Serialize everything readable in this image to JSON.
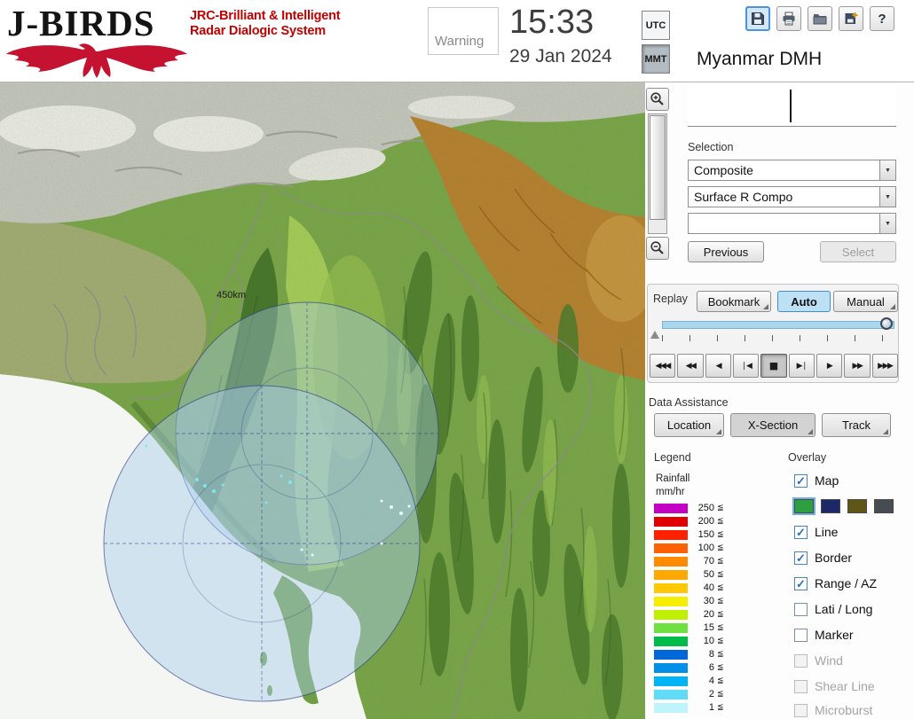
{
  "header": {
    "logo": {
      "title": "J-BIRDS",
      "tagline1": "JRC-Brilliant & Intelligent",
      "tagline2": "Radar  Dialogic  System"
    },
    "warning_label": "Warning",
    "clock": {
      "time": "15:33",
      "date": "29 Jan 2024"
    },
    "timezone": {
      "utc": "UTC",
      "mmt": "MMT",
      "selected": "MMT"
    },
    "toolbar": [
      {
        "name": "save",
        "icon": "floppy-disk"
      },
      {
        "name": "print",
        "icon": "printer"
      },
      {
        "name": "open",
        "icon": "folder"
      },
      {
        "name": "import",
        "icon": "disk-plus"
      },
      {
        "name": "help",
        "icon": "question-mark",
        "glyph": "?"
      }
    ],
    "org_name": "Myanmar DMH"
  },
  "selection_panel": {
    "label": "Selection",
    "dropdowns": [
      {
        "value": "Composite"
      },
      {
        "value": "Surface R Compo"
      },
      {
        "value": ""
      }
    ],
    "previous_label": "Previous",
    "select_label": "Select"
  },
  "replay": {
    "label": "Replay",
    "bookmark_label": "Bookmark",
    "auto_label": "Auto",
    "manual_label": "Manual",
    "playback_buttons": [
      "◀◀◀",
      "◀◀",
      "◀",
      "❘◀",
      "■",
      "▶❘",
      "▶",
      "▶▶",
      "▶▶▶"
    ]
  },
  "data_assistance": {
    "label": "Data Assistance",
    "buttons": [
      "Location",
      "X-Section",
      "Track"
    ]
  },
  "legend": {
    "title": "Legend",
    "unit_line1": "Rainfall",
    "unit_line2": "mm/hr",
    "lte_symbol": "≦",
    "items": [
      {
        "value": "250",
        "color": "#c400c4"
      },
      {
        "value": "200",
        "color": "#e00000"
      },
      {
        "value": "150",
        "color": "#ff2000"
      },
      {
        "value": "100",
        "color": "#ff6000"
      },
      {
        "value": "70",
        "color": "#ff8c00"
      },
      {
        "value": "50",
        "color": "#ffa800"
      },
      {
        "value": "40",
        "color": "#ffc800"
      },
      {
        "value": "30",
        "color": "#f6ee00"
      },
      {
        "value": "20",
        "color": "#c0f000"
      },
      {
        "value": "15",
        "color": "#6ee040"
      },
      {
        "value": "10",
        "color": "#00bc48"
      },
      {
        "value": "8",
        "color": "#0068d8"
      },
      {
        "value": "6",
        "color": "#0090e8"
      },
      {
        "value": "4",
        "color": "#00b4f8"
      },
      {
        "value": "2",
        "color": "#60dcf8"
      },
      {
        "value": "1",
        "color": "#c0f4fc"
      }
    ]
  },
  "overlay": {
    "title": "Overlay",
    "items": [
      {
        "label": "Map",
        "checked": true,
        "enabled": true
      },
      {
        "label": "Line",
        "checked": true,
        "enabled": true
      },
      {
        "label": "Border",
        "checked": true,
        "enabled": true
      },
      {
        "label": "Range / AZ",
        "checked": true,
        "enabled": true
      },
      {
        "label": "Lati / Long",
        "checked": false,
        "enabled": true
      },
      {
        "label": "Marker",
        "checked": false,
        "enabled": true
      },
      {
        "label": "Wind",
        "checked": false,
        "enabled": false
      },
      {
        "label": "Shear Line",
        "checked": false,
        "enabled": false
      },
      {
        "label": "Microburst",
        "checked": false,
        "enabled": false
      }
    ],
    "map_styles": [
      "#2f9e41",
      "#1b2a66",
      "#5e5616",
      "#474c52"
    ]
  },
  "map": {
    "range_label": "450km"
  },
  "icons": {
    "dropdown_arrow": "▼",
    "check": "✓"
  }
}
